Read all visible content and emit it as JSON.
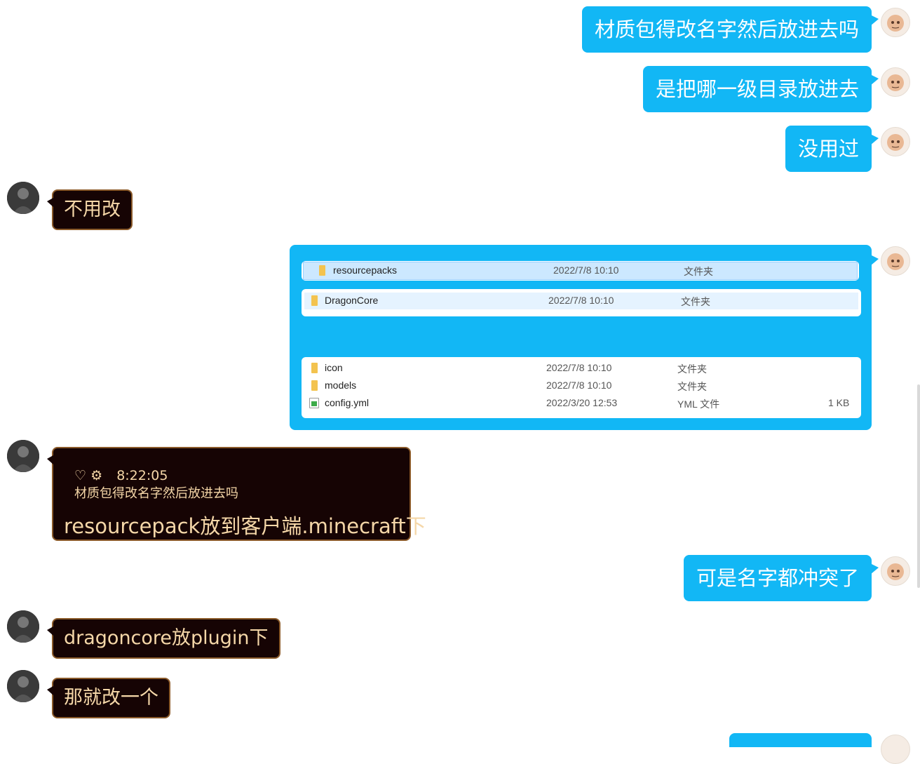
{
  "messages": [
    {
      "id": "m1",
      "side": "me",
      "text": "材质包得改名字然后放进去吗"
    },
    {
      "id": "m2",
      "side": "me",
      "text": "是把哪一级目录放进去"
    },
    {
      "id": "m3",
      "side": "me",
      "text": "没用过"
    },
    {
      "id": "m4",
      "side": "other",
      "text": "不用改"
    },
    {
      "id": "m6",
      "side": "other",
      "reply_time": "8:22:05",
      "reply_quote": "材质包得改名字然后放进去吗",
      "text": "resourcepack放到客户端.minecraft下"
    },
    {
      "id": "m7",
      "side": "me",
      "text": "可是名字都冲突了"
    },
    {
      "id": "m8",
      "side": "other",
      "text": "dragoncore放plugin下"
    },
    {
      "id": "m9",
      "side": "other",
      "text": "那就改一个"
    }
  ],
  "screenshot": {
    "panel1": [
      {
        "name": "resourcepacks",
        "date": "2022/7/8 10:10",
        "type": "文件夹",
        "size": ""
      }
    ],
    "panel2": [
      {
        "name": "DragonCore",
        "date": "2022/7/8 10:10",
        "type": "文件夹",
        "size": ""
      }
    ],
    "panel3": [
      {
        "name": "icon",
        "date": "2022/7/8 10:10",
        "type": "文件夹",
        "size": ""
      },
      {
        "name": "models",
        "date": "2022/7/8 10:10",
        "type": "文件夹",
        "size": ""
      },
      {
        "name": "config.yml",
        "date": "2022/3/20 12:53",
        "type": "YML 文件",
        "size": "1 KB"
      }
    ]
  },
  "icons": {
    "reply_like": "heart-icon",
    "reply_gear": "gear-icon"
  },
  "colors": {
    "my_bubble": "#12b7f5",
    "other_bubble": "#160404",
    "other_text": "#f5d7a8",
    "other_border": "#8a5a2a"
  }
}
